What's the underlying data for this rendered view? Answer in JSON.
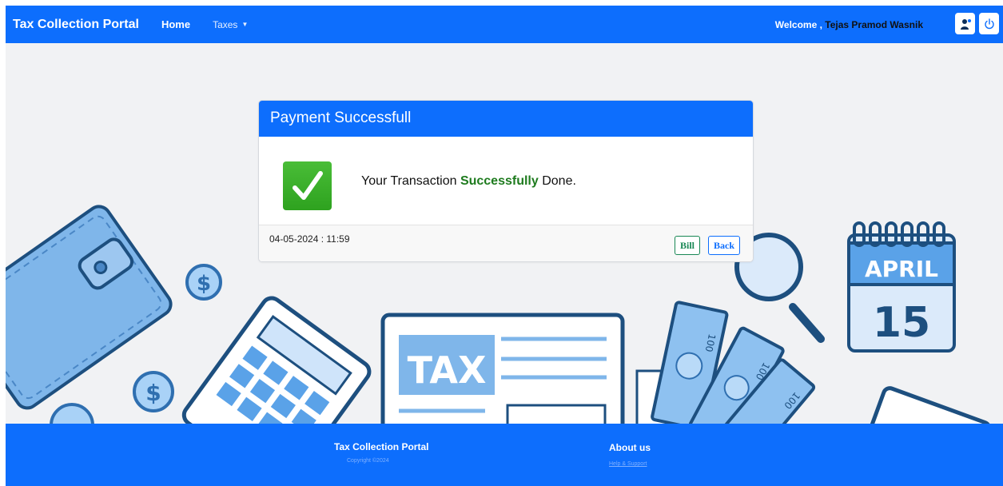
{
  "navbar": {
    "brand": "Tax Collection Portal",
    "home": "Home",
    "taxes": "Taxes",
    "welcome_prefix": "Welcome ,",
    "user_name": "Tejas Pramod Wasnik",
    "icons": [
      "user-profile-icon",
      "power-icon"
    ]
  },
  "background": {
    "tax_label": "TAX",
    "calendar_month": "APRIL",
    "calendar_day": "15",
    "bill_denomination": "100"
  },
  "card": {
    "title": "Payment Successfull",
    "message_start": "Your Transaction",
    "message_bold": "Successfully",
    "message_end": "Done.",
    "datetime": "04-05-2024 : 11:59",
    "bill_button": "Bill",
    "back_button": "Back"
  },
  "footer": {
    "title": "Tax Collection Portal",
    "copyright": "Copyright ©2024",
    "about": "About us",
    "help": "Help & Support"
  },
  "colors": {
    "primary": "#0d6efd",
    "success_green": "#1e7b1e",
    "page_bg": "#f1f2f4"
  }
}
